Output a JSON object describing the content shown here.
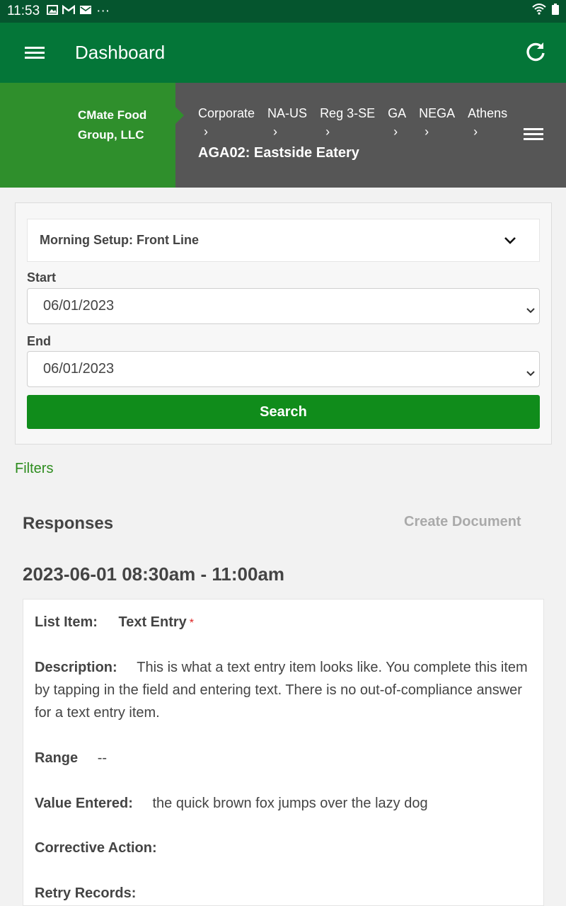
{
  "statusbar": {
    "time": "11:53",
    "dots": "···"
  },
  "appbar": {
    "title": "Dashboard"
  },
  "org": {
    "name": "CMate Food Group, LLC"
  },
  "breadcrumbs": [
    "Corporate",
    "NA-US",
    "Reg 3-SE",
    "GA",
    "NEGA",
    "Athens"
  ],
  "crumb_separator": "›",
  "location": "AGA02: Eastside Eatery",
  "checklist_select": {
    "selected": "Morning Setup: Front Line"
  },
  "start": {
    "label": "Start",
    "value": "06/01/2023"
  },
  "end": {
    "label": "End",
    "value": "06/01/2023"
  },
  "search_label": "Search",
  "filters_label": "Filters",
  "responses": {
    "title": "Responses",
    "create_document": "Create Document"
  },
  "time_range": "2023-06-01 08:30am - 11:00am",
  "item": {
    "list_item_key": "List Item:",
    "list_item_value": "Text Entry",
    "required_mark": "*",
    "description_key": "Description:",
    "description_value": "This is what a text entry item looks like. You complete this item by tapping in the field and entering text. There is no out-of-compliance answer for a text entry item.",
    "range_key": "Range",
    "range_value": "--",
    "value_key": "Value Entered:",
    "value_value": "the quick brown fox jumps over the lazy dog",
    "corrective_key": "Corrective Action:",
    "retry_key": "Retry Records:"
  },
  "colors": {
    "appbar": "#047638",
    "statusbar": "#05552e",
    "org_block": "#2f8f2c",
    "crumb_bar": "#565656",
    "search_button": "#108c1b",
    "filters_link": "#2d8c1e"
  }
}
